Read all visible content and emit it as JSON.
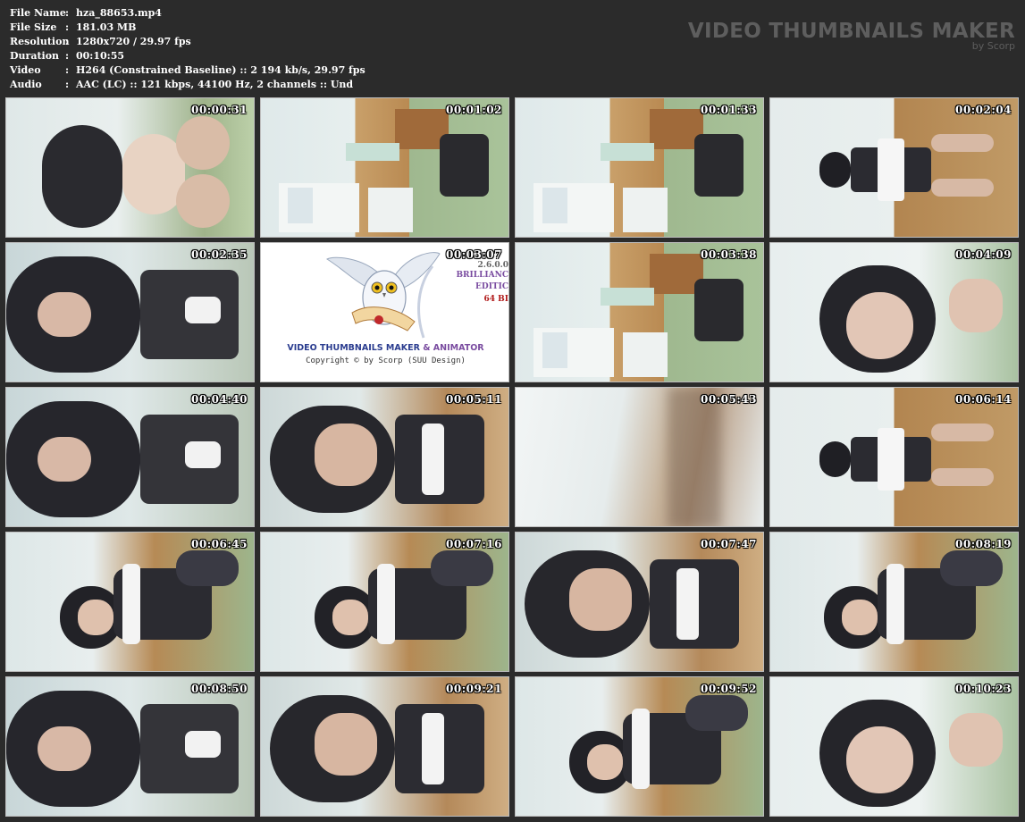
{
  "meta": [
    {
      "key": "File Name",
      "value": "hza_88653.mp4"
    },
    {
      "key": "File Size",
      "value": "181.03 MB"
    },
    {
      "key": "Resolution",
      "value": "1280x720 / 29.97 fps"
    },
    {
      "key": "Duration",
      "value": "00:10:55"
    },
    {
      "key": "Video",
      "value": "H264 (Constrained Baseline) :: 2 194 kb/s, 29.97 fps"
    },
    {
      "key": "Audio",
      "value": "AAC (LC) :: 121 kbps, 44100 Hz, 2 channels :: Und"
    }
  ],
  "separator": ":",
  "brand": {
    "title": "VIDEO THUMBNAILS MAKER",
    "by": "by Scorp"
  },
  "logo": {
    "name_a": "VIDEO THUMBNAILS MAKER",
    "name_b": " & ANIMATOR",
    "copyright": "Copyright © by Scorp (SUU Design)",
    "version": "2.6.0.0",
    "edition_1": "BRILLIANC",
    "edition_2": "EDITIC",
    "bits": "64 BI"
  },
  "thumbnails": [
    {
      "time": "00:00:31",
      "scene": "a"
    },
    {
      "time": "00:01:02",
      "scene": "room"
    },
    {
      "time": "00:01:33",
      "scene": "room"
    },
    {
      "time": "00:02:04",
      "scene": "b"
    },
    {
      "time": "00:02:35",
      "scene": "c"
    },
    {
      "time": "00:03:07",
      "scene": "logo"
    },
    {
      "time": "00:03:38",
      "scene": "room"
    },
    {
      "time": "00:04:09",
      "scene": "d"
    },
    {
      "time": "00:04:40",
      "scene": "c"
    },
    {
      "time": "00:05:11",
      "scene": "e"
    },
    {
      "time": "00:05:43",
      "scene": "blur"
    },
    {
      "time": "00:06:14",
      "scene": "b"
    },
    {
      "time": "00:06:45",
      "scene": "f"
    },
    {
      "time": "00:07:16",
      "scene": "f"
    },
    {
      "time": "00:07:47",
      "scene": "e"
    },
    {
      "time": "00:08:19",
      "scene": "f"
    },
    {
      "time": "00:08:50",
      "scene": "c"
    },
    {
      "time": "00:09:21",
      "scene": "e"
    },
    {
      "time": "00:09:52",
      "scene": "f"
    },
    {
      "time": "00:10:23",
      "scene": "d"
    }
  ],
  "colors": {
    "background": "#2b2b2b",
    "brand_text": "#5e5e5e",
    "logo_blue": "#2a3c8f",
    "logo_red": "#c02020",
    "logo_purple": "#7a4ca0"
  }
}
